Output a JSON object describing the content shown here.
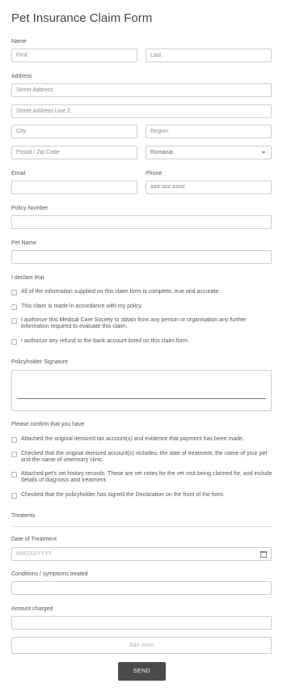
{
  "title": "Pet Insurance Claim Form",
  "name": {
    "label": "Name",
    "first_placeholder": "First",
    "last_placeholder": "Last"
  },
  "address": {
    "label": "Address",
    "street1": "Street Address",
    "street2": "Street Address Line 2",
    "city": "City",
    "region": "Region",
    "postal": "Postal / Zip Code",
    "country": "Romania"
  },
  "email": {
    "label": "Email",
    "value": ""
  },
  "phone": {
    "label": "Phone",
    "placeholder": "### ### ####"
  },
  "policy_number": {
    "label": "Policy Number",
    "value": ""
  },
  "pet_name": {
    "label": "Pet Name",
    "value": ""
  },
  "declare": {
    "label": "I declare that",
    "items": [
      "All of the information supplied on this claim form is complete, true and accurate.",
      "This claim is made in accordance with my policy.",
      "I authorize this Medical Care Society to obtain from any person or organisation any further information required to evaluate this claim.",
      "I authorize any refund to the bank account listed on this claim form."
    ]
  },
  "signature": {
    "label": "Policyholder Signature"
  },
  "confirm": {
    "label": "Please confirm that you have",
    "items": [
      "Attached the original itemized tax account(s) and evidence that payment has been made.",
      "Checked that the original itemized account(s) includes: the date of treatment, the name of your pet and the name of veterinary clinic.",
      "Attached pet's vet history records. These are vet notes for the vet visit being claimed for, and include details of diagnosis and treatment.",
      "Checked that the policyholder has signed the Declaration on the front of the form."
    ]
  },
  "treatments": {
    "label": "Treatents",
    "date_label": "Date of Treatment",
    "date_placeholder": "MM/DD/YYYY",
    "conditions_label": "Conditions / symptoms treated",
    "amount_label": "Amount charged",
    "add_more": "Add more"
  },
  "send": "SEND"
}
